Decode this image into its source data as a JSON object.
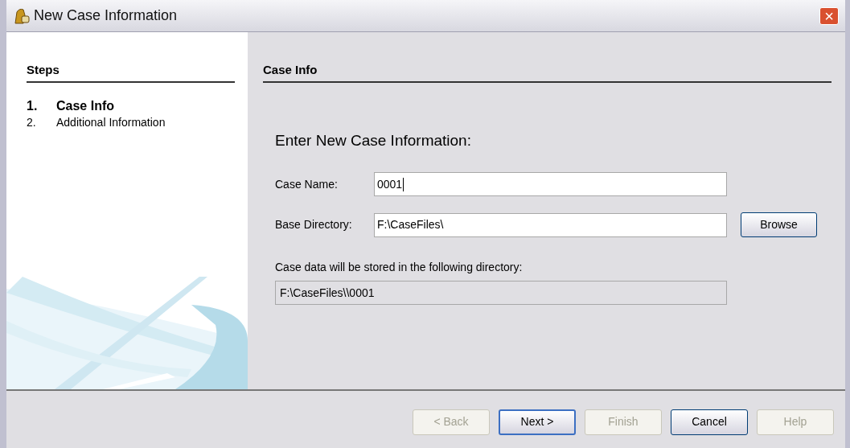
{
  "window": {
    "title": "New Case Information",
    "close": "×"
  },
  "steps": {
    "heading": "Steps",
    "items": [
      {
        "number": "1.",
        "label": "Case Info",
        "selected": true
      },
      {
        "number": "2.",
        "label": "Additional Information",
        "selected": false
      }
    ]
  },
  "panel": {
    "heading": "Case Info",
    "title": "Enter New Case Information:",
    "fields": [
      {
        "label": "Case Name:",
        "value": "0001",
        "focused": true
      },
      {
        "label": "Base Directory:",
        "value": "F:\\CaseFiles\\",
        "focused": false,
        "button": "Browse"
      }
    ],
    "output_label": "Case data will be stored in the following directory:",
    "output": {
      "value": "F:\\CaseFiles\\\\0001",
      "disabled": true
    }
  },
  "buttons": [
    {
      "label": "< Back",
      "disabled": true,
      "default": false
    },
    {
      "label": "Next >",
      "disabled": false,
      "default": true
    },
    {
      "label": "Finish",
      "disabled": true,
      "default": false
    },
    {
      "label": "Cancel",
      "disabled": false,
      "default": false
    },
    {
      "label": "Help",
      "disabled": true,
      "default": false
    }
  ]
}
